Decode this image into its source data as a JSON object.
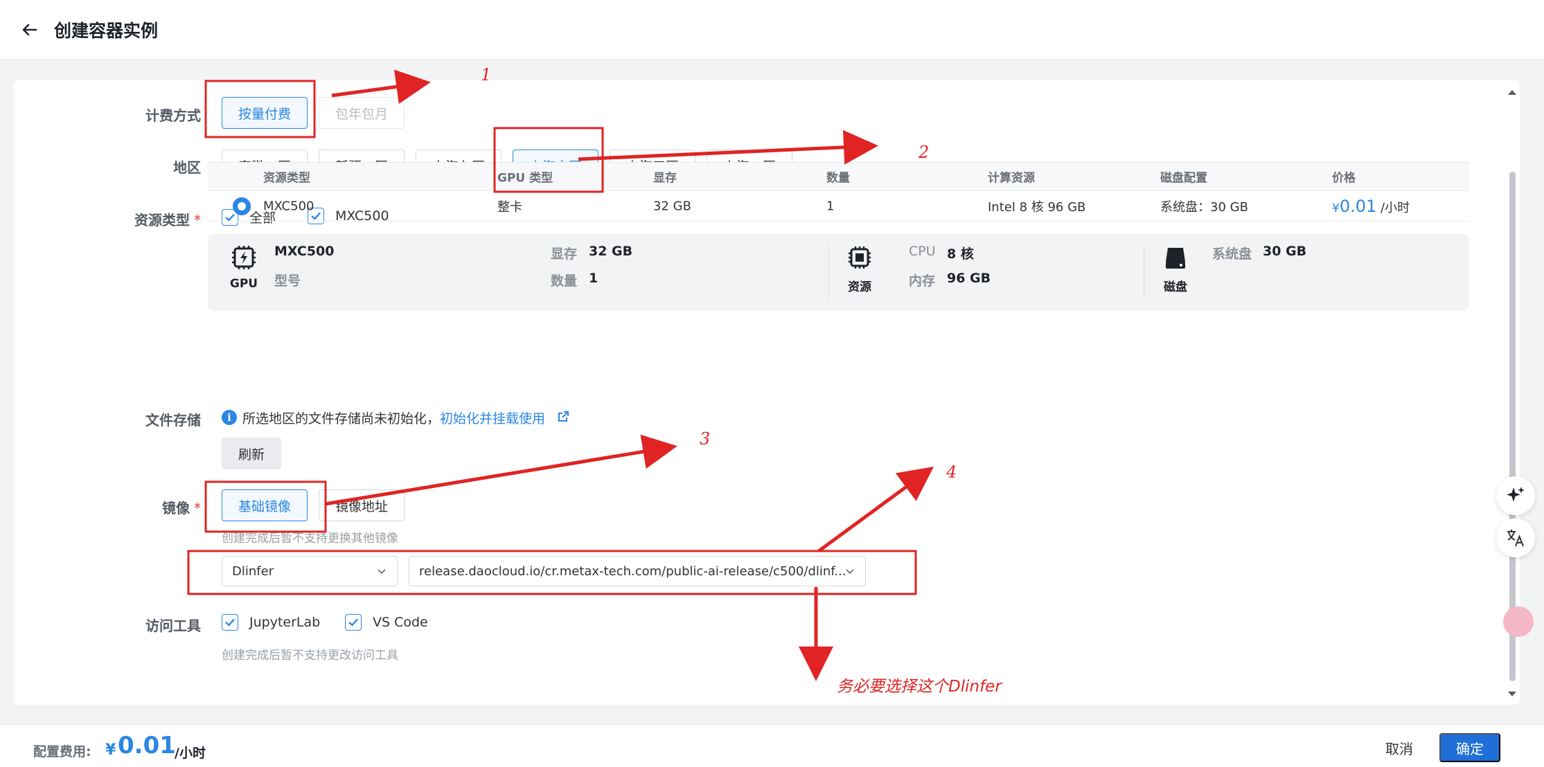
{
  "header": {
    "title": "创建容器实例"
  },
  "billing": {
    "label": "计费方式",
    "options": [
      "按量付费",
      "包年包月"
    ]
  },
  "region": {
    "label": "地区",
    "options": [
      "安徽一区",
      "新疆一区",
      "上海七区",
      "上海六区",
      "上海三区",
      "上海一区"
    ]
  },
  "resource_type": {
    "label": "资源类型",
    "required": "*",
    "checks": [
      "全部",
      "MXC500"
    ],
    "table": {
      "headers": [
        "资源类型",
        "GPU 类型",
        "显存",
        "数量",
        "计算资源",
        "磁盘配置",
        "价格"
      ],
      "row": {
        "type": "MXC500",
        "gpu_type": "整卡",
        "vram": "32 GB",
        "count": "1",
        "compute": "Intel 8 核 96 GB",
        "disk": "系统盘：30 GB",
        "price_symbol": "¥",
        "price": "0.01",
        "price_unit": "/小时"
      }
    },
    "spec": {
      "gpu_caption": "GPU",
      "model": "MXC500",
      "model_label": "型号",
      "vram_label": "显存",
      "vram": "32 GB",
      "count_label": "数量",
      "count": "1",
      "res_caption": "资源",
      "cpu_label": "CPU",
      "cpu": "8 核",
      "mem_label": "内存",
      "mem": "96 GB",
      "disk_caption": "磁盘",
      "sysdisk_label": "系统盘",
      "sysdisk": "30 GB"
    }
  },
  "storage": {
    "label": "文件存储",
    "notice": "所选地区的文件存储尚未初始化，",
    "link": "初始化并挂载使用",
    "refresh": "刷新"
  },
  "image": {
    "label": "镜像",
    "required": "*",
    "options": [
      "基础镜像",
      "镜像地址"
    ],
    "hint": "创建完成后暂不支持更换其他镜像",
    "framework": "Dlinfer",
    "address": "release.daocloud.io/cr.metax-tech.com/public-ai-release/c500/dlinf..."
  },
  "tools": {
    "label": "访问工具",
    "checks": [
      "JupyterLab",
      "VS Code"
    ],
    "hint": "创建完成后暂不支持更改访问工具"
  },
  "footer": {
    "fee_label": "配置费用:",
    "fee_symbol": "¥",
    "fee": "0.01",
    "fee_unit": "/小时",
    "cancel": "取消",
    "confirm": "确定"
  },
  "annotations": {
    "n1": "1",
    "n2": "2",
    "n3": "3",
    "n4": "4",
    "note": "务必要选择这个Dlinfer"
  },
  "colors": {
    "accent": "#2a86e4",
    "annotation": "#e02424"
  }
}
